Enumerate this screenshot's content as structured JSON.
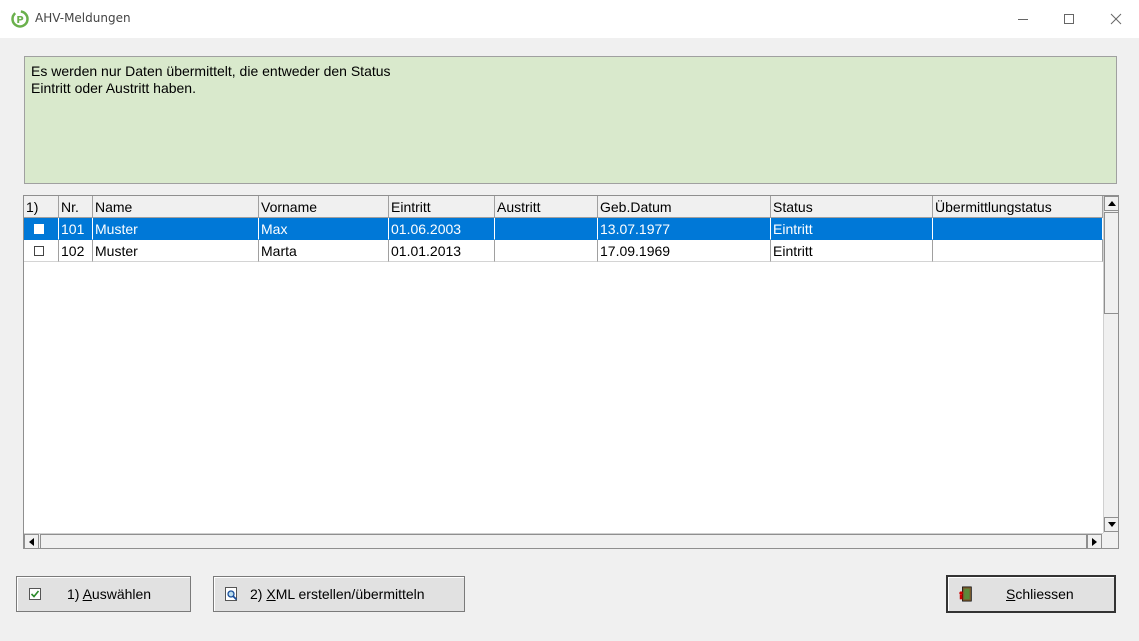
{
  "window": {
    "title": "AHV-Meldungen",
    "controls": {
      "minimize": "—",
      "maximize": "☐",
      "close": "✕"
    }
  },
  "info": {
    "line1": "Es werden nur Daten übermittelt, die entweder den Status",
    "line2": "Eintritt oder Austritt haben."
  },
  "table": {
    "columns": [
      "1)",
      "Nr.",
      "Name",
      "Vorname",
      "Eintritt",
      "Austritt",
      "Geb.Datum",
      "Status",
      "Übermittlungstatus"
    ],
    "rows": [
      {
        "checked": false,
        "nr": "101",
        "name": "Muster",
        "vorname": "Max",
        "eintritt": "01.06.2003",
        "austritt": "",
        "geb_datum": "13.07.1977",
        "status": "Eintritt",
        "uebermittlungstatus": "",
        "selected": true
      },
      {
        "checked": false,
        "nr": "102",
        "name": "Muster",
        "vorname": "Marta",
        "eintritt": "01.01.2013",
        "austritt": "",
        "geb_datum": "17.09.1969",
        "status": "Eintritt",
        "uebermittlungstatus": "",
        "selected": false
      }
    ]
  },
  "buttons": {
    "select_prefix": "1) ",
    "select_hot": "A",
    "select_rest": "uswählen",
    "xml_prefix": "2) ",
    "xml_hot": "X",
    "xml_rest": "ML erstellen/übermitteln",
    "close_hot": "S",
    "close_rest": "chliessen"
  },
  "icons": {
    "app": "app-logo-icon",
    "select": "checkbox-check-icon",
    "xml": "document-magnifier-icon",
    "close": "exit-door-icon"
  },
  "colors": {
    "selection": "#0078d7",
    "info_panel": "#d9e9cc"
  }
}
